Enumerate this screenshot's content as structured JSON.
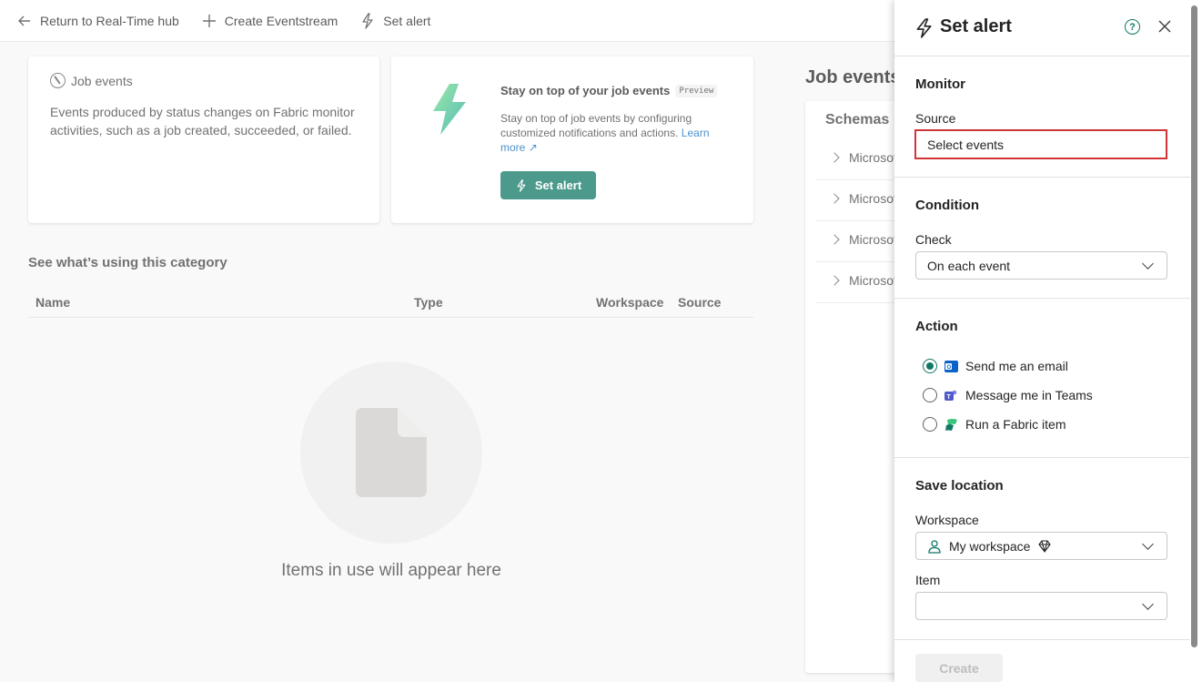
{
  "toolbar": {
    "return_label": "Return to Real-Time hub",
    "create_label": "Create Eventstream",
    "alert_label": "Set alert"
  },
  "card_job": {
    "title": "Job events",
    "description": "Events produced by status changes on Fabric monitor activities, such as a job created, succeeded, or failed."
  },
  "card_alert": {
    "title": "Stay on top of your job events",
    "badge": "Preview",
    "description": "Stay on top of job events by configuring customized notifications and actions.",
    "link": "Learn more",
    "button": "Set alert"
  },
  "usage": {
    "title": "See what’s using this category",
    "columns": [
      "Name",
      "Type",
      "Workspace",
      "Source"
    ],
    "empty_text": "Items in use will appear here"
  },
  "right_pane": {
    "title": "Job events",
    "schemas_label": "Schemas",
    "rows": [
      "Microsoft",
      "Microsoft",
      "Microsoft",
      "Microsoft"
    ]
  },
  "panel": {
    "title": "Set alert",
    "monitor": {
      "section": "Monitor",
      "source_label": "Source",
      "source_value": "Select events"
    },
    "condition": {
      "section": "Condition",
      "check_label": "Check",
      "check_value": "On each event"
    },
    "action": {
      "section": "Action",
      "options": [
        "Send me an email",
        "Message me in Teams",
        "Run a Fabric item"
      ],
      "selected": "Send me an email"
    },
    "save": {
      "section": "Save location",
      "workspace_label": "Workspace",
      "workspace_value": "My workspace",
      "item_label": "Item",
      "item_value": ""
    },
    "create_button": "Create"
  },
  "colors": {
    "accent": "#117865",
    "error_outline": "#d13438",
    "link": "#0f6cbd"
  }
}
